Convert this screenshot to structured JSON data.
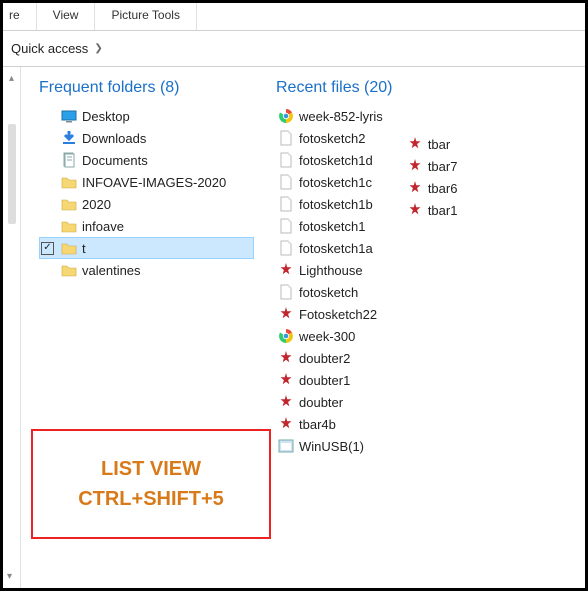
{
  "tabs": {
    "share": "re",
    "view": "View",
    "picture_tools": "Picture Tools"
  },
  "address": {
    "location": "Quick access"
  },
  "frequent": {
    "heading": "Frequent folders (8)",
    "items": [
      {
        "label": "Desktop",
        "icon": "desktop"
      },
      {
        "label": "Downloads",
        "icon": "download"
      },
      {
        "label": "Documents",
        "icon": "documents"
      },
      {
        "label": "INFOAVE-IMAGES-2020",
        "icon": "folder"
      },
      {
        "label": "2020",
        "icon": "folder"
      },
      {
        "label": "infoave",
        "icon": "folder"
      },
      {
        "label": "t",
        "icon": "folder",
        "selected": true,
        "checked": true
      },
      {
        "label": "valentines",
        "icon": "folder"
      }
    ]
  },
  "recent": {
    "heading": "Recent files (20)",
    "colA": [
      {
        "label": "week-852-lyris",
        "icon": "chrome"
      },
      {
        "label": "fotosketch2",
        "icon": "file"
      },
      {
        "label": "fotosketch1d",
        "icon": "file"
      },
      {
        "label": "fotosketch1c",
        "icon": "file"
      },
      {
        "label": "fotosketch1b",
        "icon": "file"
      },
      {
        "label": "fotosketch1",
        "icon": "file"
      },
      {
        "label": "fotosketch1a",
        "icon": "file"
      },
      {
        "label": "Lighthouse",
        "icon": "irfan"
      },
      {
        "label": "fotosketch",
        "icon": "file"
      },
      {
        "label": "Fotosketch22",
        "icon": "irfan"
      },
      {
        "label": "week-300",
        "icon": "chrome"
      },
      {
        "label": "doubter2",
        "icon": "irfan"
      },
      {
        "label": "doubter1",
        "icon": "irfan"
      },
      {
        "label": "doubter",
        "icon": "irfan"
      },
      {
        "label": "tbar4b",
        "icon": "irfan"
      },
      {
        "label": "WinUSB(1)",
        "icon": "app"
      }
    ],
    "colB": [
      {
        "label": "tbar",
        "icon": "irfan"
      },
      {
        "label": "tbar7",
        "icon": "irfan"
      },
      {
        "label": "tbar6",
        "icon": "irfan"
      },
      {
        "label": "tbar1",
        "icon": "irfan"
      }
    ]
  },
  "annotation": {
    "line1": "LIST VIEW",
    "line2": "CTRL+SHIFT+5"
  }
}
